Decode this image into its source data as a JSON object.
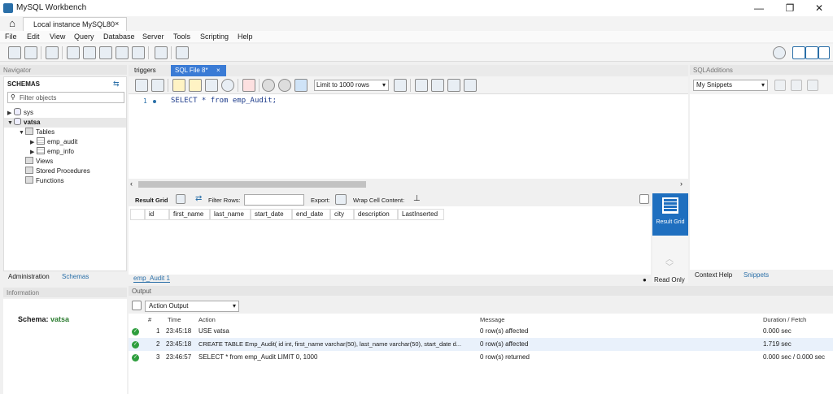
{
  "window": {
    "title": "MySQL Workbench",
    "minimize": "—",
    "maximize": "❐",
    "close": "✕"
  },
  "connection_tab": {
    "label": "Local instance MySQL80",
    "close": "×"
  },
  "menu": [
    "File",
    "Edit",
    "View",
    "Query",
    "Database",
    "Server",
    "Tools",
    "Scripting",
    "Help"
  ],
  "navigator": {
    "header": "Navigator",
    "schemas_title": "SCHEMAS",
    "filter_placeholder": "Filter objects",
    "tree": {
      "sys": "sys",
      "vatsa": "vatsa",
      "tables": "Tables",
      "emp_audit": "emp_audit",
      "emp_info": "emp_info",
      "views": "Views",
      "stored_procedures": "Stored Procedures",
      "functions": "Functions"
    },
    "bottom_tabs": [
      "Administration",
      "Schemas"
    ],
    "info_header": "Information",
    "schema_label": "Schema:",
    "schema_value": "vatsa"
  },
  "editor": {
    "tabs": [
      "triggers",
      "SQL File 8*"
    ],
    "tab_close": "×",
    "limit_label": "Limit to 1000 rows",
    "line_number": "1",
    "code": "SELECT * from emp_Audit;"
  },
  "result": {
    "grid_label": "Result Grid",
    "filter_rows": "Filter Rows:",
    "export": "Export:",
    "wrap": "Wrap Cell Content:",
    "columns": [
      "id",
      "first_name",
      "last_name",
      "start_date",
      "end_date",
      "city",
      "description",
      "LastInserted"
    ],
    "side_label": "Result Grid",
    "read_only": "Read Only",
    "tab": "emp_Audit 1"
  },
  "sql_additions": {
    "header": "SQLAdditions",
    "snippets_select": "My Snippets",
    "tabs": [
      "Context Help",
      "Snippets"
    ]
  },
  "output": {
    "header": "Output",
    "select": "Action Output",
    "columns": {
      "num": "#",
      "time": "Time",
      "action": "Action",
      "message": "Message",
      "duration": "Duration / Fetch"
    },
    "rows": [
      {
        "num": "1",
        "time": "23:45:18",
        "action": "USE vatsa",
        "message": "0 row(s) affected",
        "duration": "0.000 sec"
      },
      {
        "num": "2",
        "time": "23:45:18",
        "action": "CREATE TABLE Emp_Audit( id int, first_name varchar(50), last_name varchar(50), start_date d...",
        "message": "0 row(s) affected",
        "duration": "1.719 sec"
      },
      {
        "num": "3",
        "time": "23:46:57",
        "action": "SELECT * from emp_Audit LIMIT 0, 1000",
        "message": "0 row(s) returned",
        "duration": "0.000 sec / 0.000 sec"
      }
    ]
  },
  "colors": {
    "accent": "#3a7bd5",
    "result_grid_blue": "#1f6fbf",
    "ok_green": "#2e9e3e"
  }
}
